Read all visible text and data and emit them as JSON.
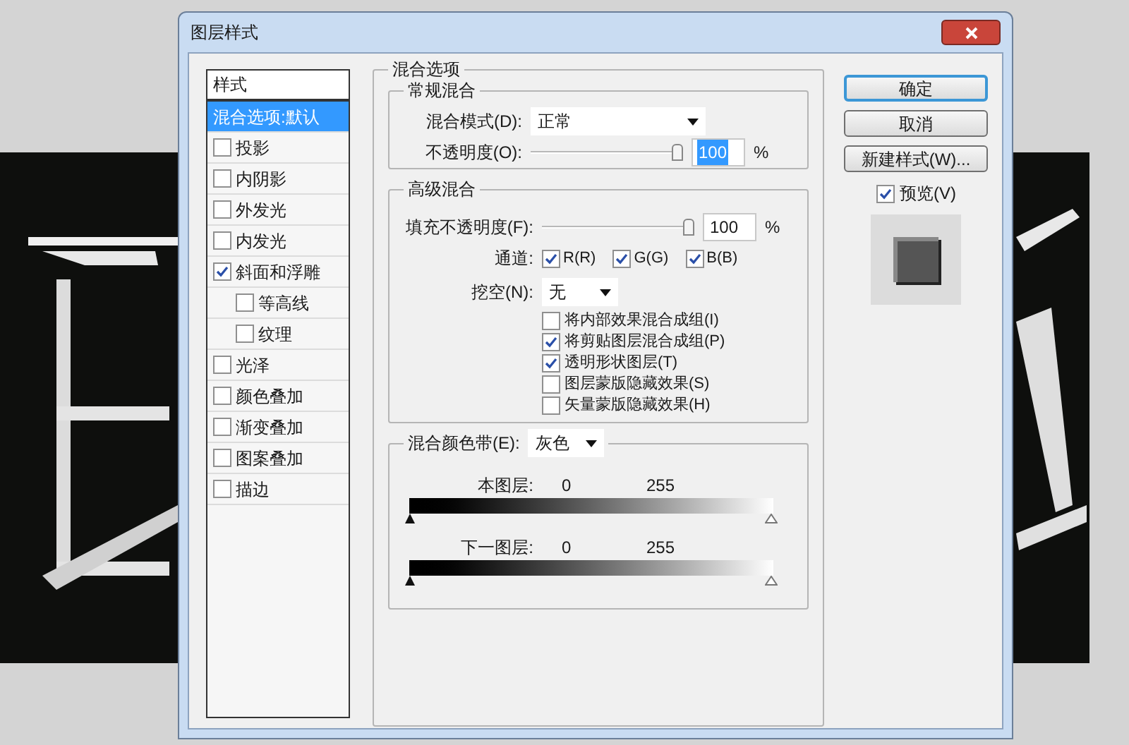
{
  "window": {
    "title": "图层样式"
  },
  "styles": {
    "header": "样式",
    "items": [
      {
        "label": "混合选项:默认",
        "kind": "plain",
        "selected": true
      },
      {
        "label": "投影",
        "kind": "effect",
        "checked": false,
        "selected": false
      },
      {
        "label": "内阴影",
        "kind": "effect",
        "checked": false,
        "selected": false
      },
      {
        "label": "外发光",
        "kind": "effect",
        "checked": false,
        "selected": false
      },
      {
        "label": "内发光",
        "kind": "effect",
        "checked": false,
        "selected": false
      },
      {
        "label": "斜面和浮雕",
        "kind": "effect",
        "checked": true,
        "selected": false,
        "children": [
          {
            "label": "等高线",
            "kind": "effect",
            "checked": false,
            "selected": false
          },
          {
            "label": "纹理",
            "kind": "effect",
            "checked": false,
            "selected": false
          }
        ]
      },
      {
        "label": "光泽",
        "kind": "effect",
        "checked": false,
        "selected": false
      },
      {
        "label": "颜色叠加",
        "kind": "effect",
        "checked": false,
        "selected": false
      },
      {
        "label": "渐变叠加",
        "kind": "effect",
        "checked": false,
        "selected": false
      },
      {
        "label": "图案叠加",
        "kind": "effect",
        "checked": false,
        "selected": false
      },
      {
        "label": "描边",
        "kind": "effect",
        "checked": false,
        "selected": false
      }
    ]
  },
  "blending_options": {
    "title": "混合选项",
    "general": {
      "title": "常规混合",
      "blend_mode": {
        "label": "混合模式(D):",
        "value": "正常"
      },
      "opacity": {
        "label": "不透明度(O):",
        "level": 1,
        "value": "100",
        "highlighted": true,
        "unit": "%"
      }
    },
    "advanced": {
      "title": "高级混合",
      "fill_opacity": {
        "label": "填充不透明度(F):",
        "level": 1,
        "value": "100",
        "highlighted": false,
        "unit": "%"
      },
      "channels": {
        "label": "通道:",
        "items": [
          {
            "label": "R(R)",
            "checked": true
          },
          {
            "label": "G(G)",
            "checked": true
          },
          {
            "label": "B(B)",
            "checked": true
          }
        ]
      },
      "knockout": {
        "label": "挖空(N):",
        "value": "无"
      },
      "options": [
        {
          "label": "将内部效果混合成组(I)",
          "checked": false
        },
        {
          "label": "将剪贴图层混合成组(P)",
          "checked": true
        },
        {
          "label": "透明形状图层(T)",
          "checked": true
        },
        {
          "label": "图层蒙版隐藏效果(S)",
          "checked": false
        },
        {
          "label": "矢量蒙版隐藏效果(H)",
          "checked": false
        }
      ]
    },
    "blend_if": {
      "label": "混合颜色带(E):",
      "value": "灰色",
      "bars": [
        {
          "label": "本图层:",
          "low": "0",
          "high": "255"
        },
        {
          "label": "下一图层:",
          "low": "0",
          "high": "255"
        }
      ]
    }
  },
  "buttons": [
    {
      "label": "确定",
      "default": true
    },
    {
      "label": "取消",
      "default": false
    },
    {
      "label": "新建样式(W)...",
      "default": false
    }
  ],
  "preview": {
    "label": "预览(V)",
    "checked": true
  }
}
